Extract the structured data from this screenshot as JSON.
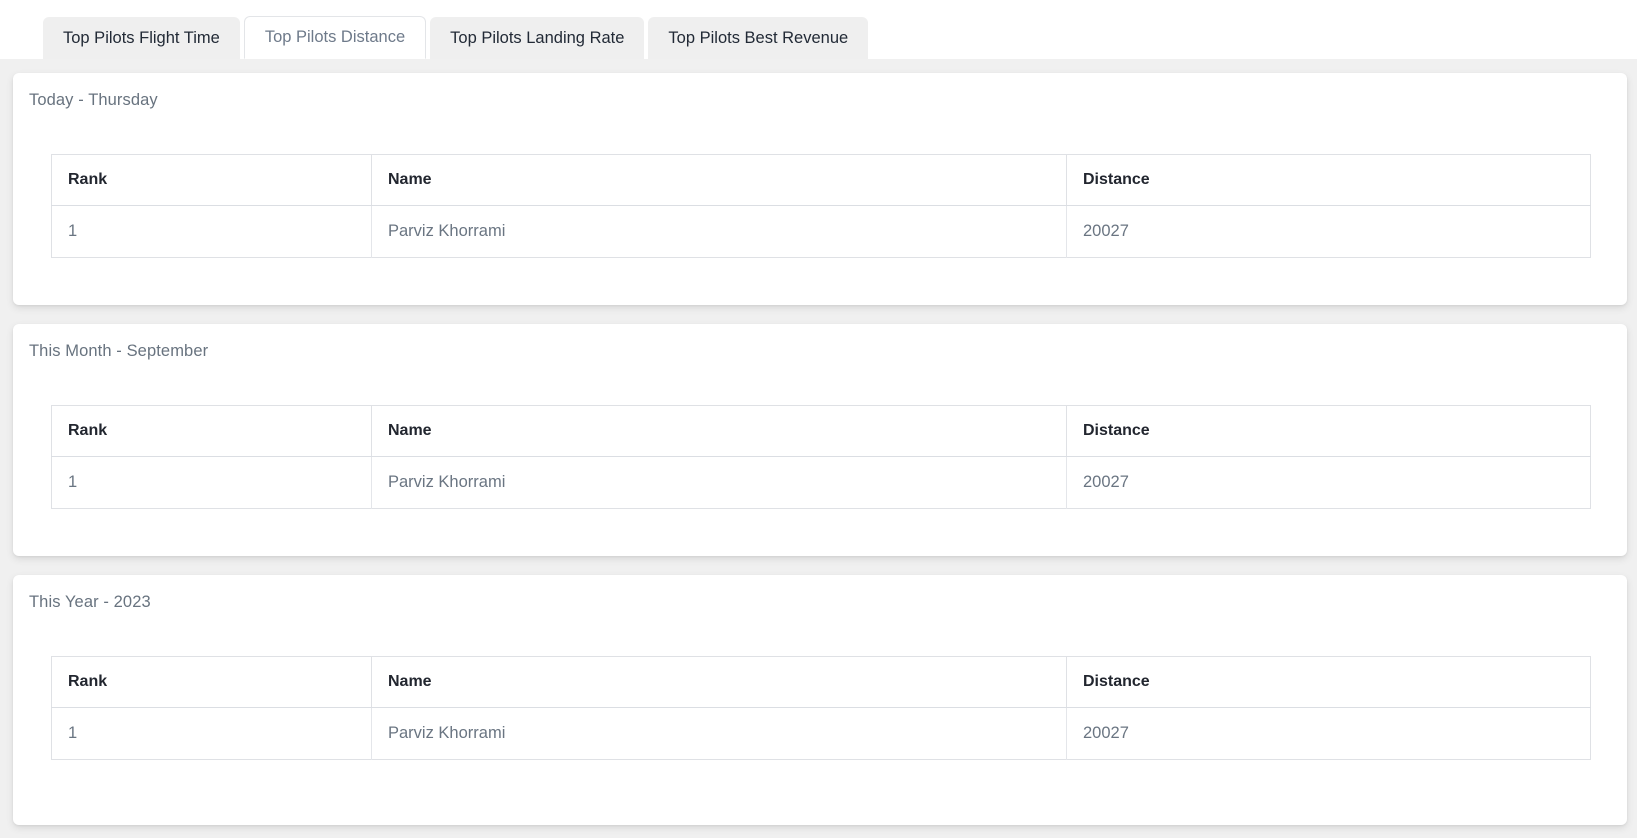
{
  "tabs": [
    {
      "label": "Top Pilots Flight Time",
      "active": false
    },
    {
      "label": "Top Pilots Distance",
      "active": true
    },
    {
      "label": "Top Pilots Landing Rate",
      "active": false
    },
    {
      "label": "Top Pilots Best Revenue",
      "active": false
    }
  ],
  "colors": {
    "page_background": "#f0f0f0",
    "card_background": "#ffffff",
    "tab_inactive_background": "#efefef",
    "tab_active_text": "#6e7a8a",
    "heading_text": "#22262f",
    "muted_text": "#68737f",
    "table_border": "#dfe1e5"
  },
  "cards": [
    {
      "title": "Today - Thursday",
      "columns": [
        "Rank",
        "Name",
        "Distance"
      ],
      "rows": [
        {
          "rank": "1",
          "name": "Parviz Khorrami",
          "distance": "20027"
        }
      ]
    },
    {
      "title": "This Month - September",
      "columns": [
        "Rank",
        "Name",
        "Distance"
      ],
      "rows": [
        {
          "rank": "1",
          "name": "Parviz Khorrami",
          "distance": "20027"
        }
      ]
    },
    {
      "title": "This Year - 2023",
      "columns": [
        "Rank",
        "Name",
        "Distance"
      ],
      "rows": [
        {
          "rank": "1",
          "name": "Parviz Khorrami",
          "distance": "20027"
        }
      ]
    }
  ]
}
